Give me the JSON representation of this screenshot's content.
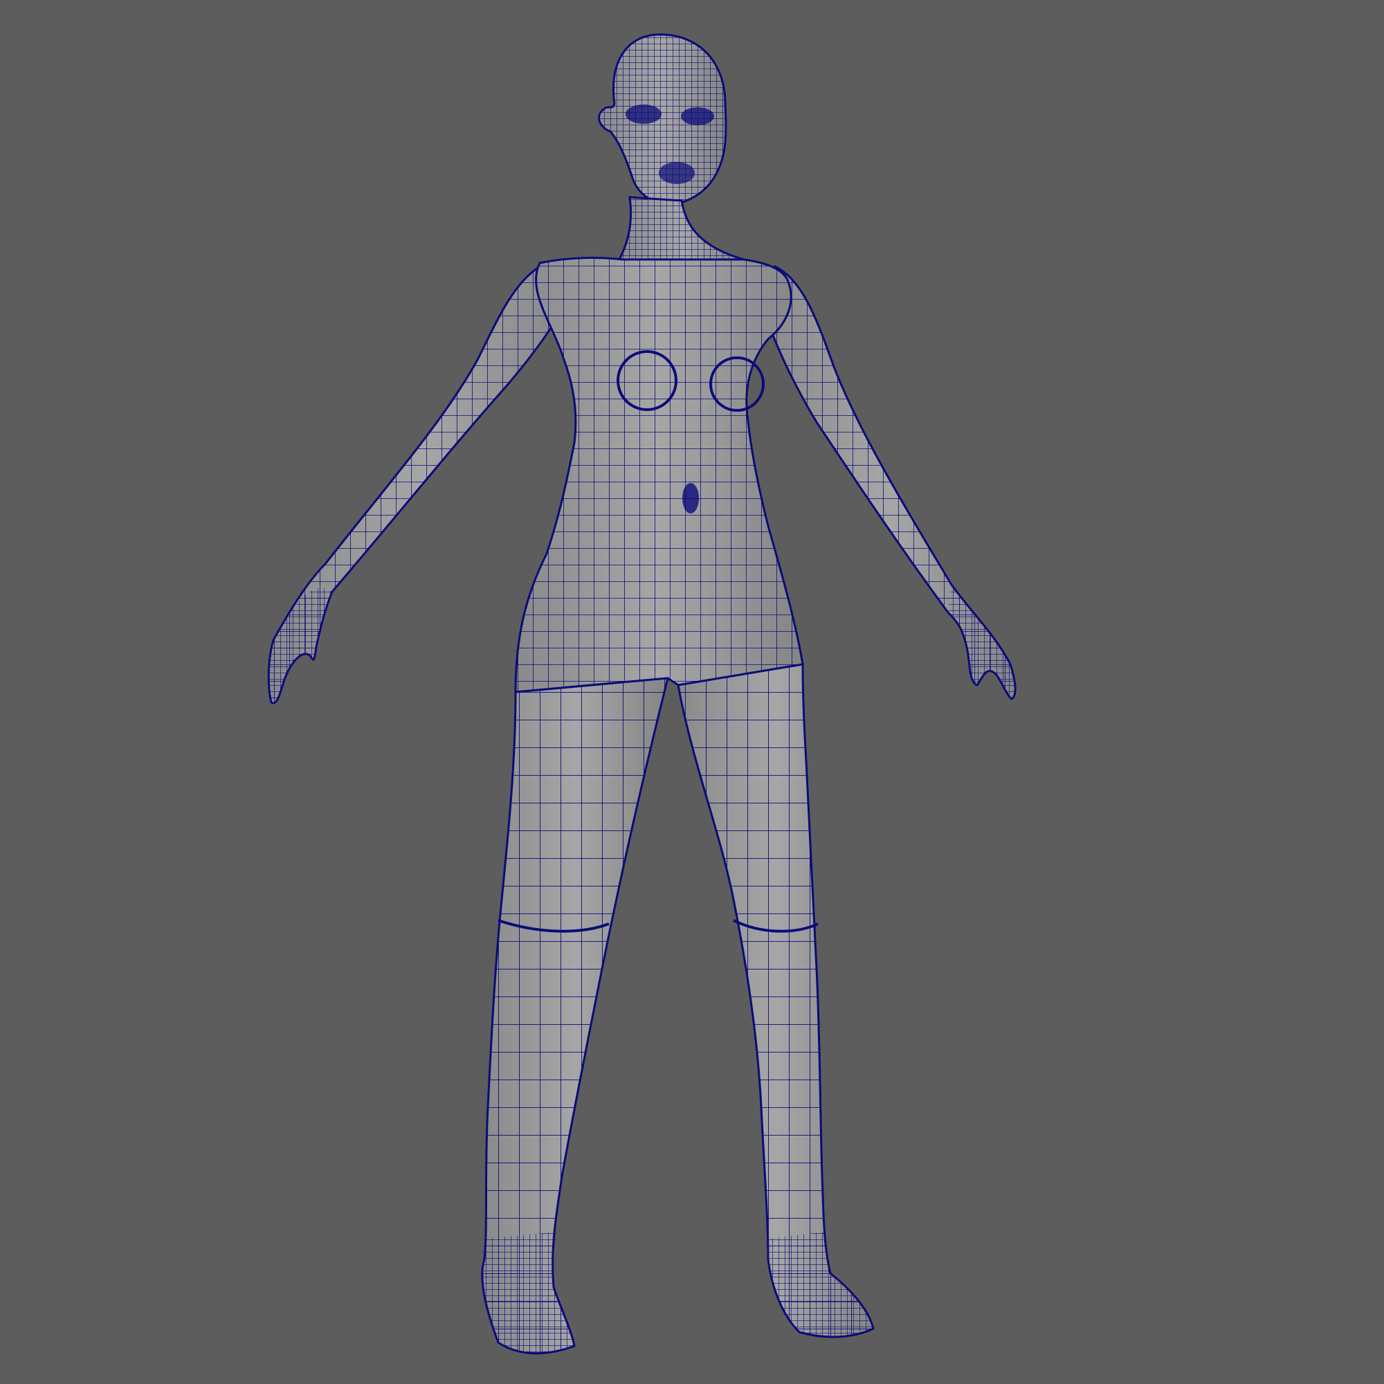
{
  "viewport": {
    "background_color": "#5d5d5d",
    "display_mode": "wireframe-on-shaded",
    "camera": "front",
    "model_pose": "A-pose"
  },
  "model": {
    "name": "female-base-mesh",
    "surface_color": "#9c9c9c",
    "shadow_color": "#7a7a7a",
    "wireframe_color": "#0b0b7a"
  }
}
